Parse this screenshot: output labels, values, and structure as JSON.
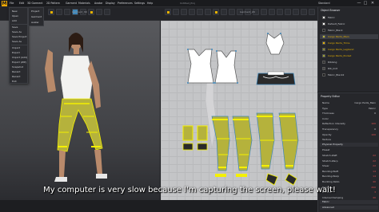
{
  "menubar": {
    "items": [
      "File",
      "Edit",
      "3D Garment",
      "2D Pattern",
      "Garment",
      "Materials",
      "Avatar",
      "Display",
      "Preferences",
      "Settings",
      "Help"
    ],
    "window_title": "Untitled_Proj",
    "product": "Standard",
    "window_buttons": [
      "—",
      "□",
      "✕"
    ]
  },
  "file_menu": {
    "items": [
      "New",
      "Open",
      "Add",
      "Save",
      "Save As",
      "Save Project",
      "Save As",
      "Import",
      "Export",
      "Import (Add)",
      "Export (ZIP)",
      "Snapshot",
      "Recent",
      "Recent",
      "Exit"
    ],
    "submenu": [
      "Project",
      "Garment",
      "Avatar"
    ]
  },
  "viewport_3d": {
    "label": "Garment_3D"
  },
  "viewport_2d": {
    "label": "Garment_2D"
  },
  "object_browser": {
    "title": "Object Browser",
    "rows": [
      {
        "label": "Fabric",
        "value": "",
        "color": "#e6e6e6",
        "style": "plain"
      },
      {
        "label": "Default_Fabric",
        "value": "",
        "color": "#ffffff",
        "style": "plain"
      },
      {
        "label": "Fabric_Black",
        "value": "",
        "color": "#222222",
        "style": "plain"
      },
      {
        "label": "Cargo Pants_Main",
        "value": "",
        "color": "#b8b63a",
        "style": "gold"
      },
      {
        "label": "Cargo Pants_Trims",
        "value": "",
        "color": "#e6b100",
        "style": "gold"
      },
      {
        "label": "Cargo Pants_Legband",
        "value": "",
        "color": "#8a8a2a",
        "style": "gold"
      },
      {
        "label": "Cargo Pants_Pocket",
        "value": "",
        "color": "#9aa030",
        "style": "gold"
      },
      {
        "label": "Ribbing",
        "value": "",
        "color": "#333333",
        "style": "plain"
      },
      {
        "label": "Rib_knit",
        "value": "",
        "color": "#444444",
        "style": "plain"
      },
      {
        "label": "Fabric_Black2",
        "value": "",
        "color": "#1c1c1c",
        "style": "plain"
      }
    ]
  },
  "property_editor": {
    "title": "Property Editor",
    "rows": [
      {
        "label": "Name",
        "value": "Cargo Pants_Main",
        "style": "plain"
      },
      {
        "label": "Type",
        "value": "Fabric",
        "style": "plain"
      },
      {
        "label": "Thickness",
        "value": "0",
        "style": "plain"
      },
      {
        "label": "Color",
        "value": "",
        "style": "plain"
      },
      {
        "label": "Reflection Intensity",
        "value": "100",
        "style": "red"
      },
      {
        "label": "Transparency",
        "value": "0",
        "style": "plain"
      },
      {
        "label": "Opacity",
        "value": "100",
        "style": "red"
      },
      {
        "label": "Texture",
        "value": "",
        "style": "plain"
      },
      {
        "label": "Physical Property",
        "value": "",
        "style": "section"
      },
      {
        "label": "Preset",
        "value": "",
        "style": "plain"
      },
      {
        "label": "Stretch-Weft",
        "value": "22",
        "style": "red"
      },
      {
        "label": "Stretch-Warp",
        "value": "22",
        "style": "red"
      },
      {
        "label": "Shear",
        "value": "22",
        "style": "red"
      },
      {
        "label": "Bending-Weft",
        "value": "14",
        "style": "red"
      },
      {
        "label": "Bending-Warp",
        "value": "14",
        "style": "red"
      },
      {
        "label": "Buckling Ratio",
        "value": "40",
        "style": "red"
      },
      {
        "label": "Density",
        "value": "200",
        "style": "red"
      },
      {
        "label": "Friction",
        "value": "3",
        "style": "red"
      },
      {
        "label": "Internal Damping",
        "value": "40",
        "style": "red"
      },
      {
        "label": "Fabric",
        "value": "",
        "style": "section"
      },
      {
        "label": "Advanced",
        "value": "",
        "style": "section"
      }
    ]
  },
  "subtitle": "My computer is very slow because I'm capturing the screen, please wait!",
  "colors": {
    "accent": "#e6b100",
    "pants": "#b9b53e",
    "trim": "#f4f000",
    "selection": "#3e86b8"
  }
}
